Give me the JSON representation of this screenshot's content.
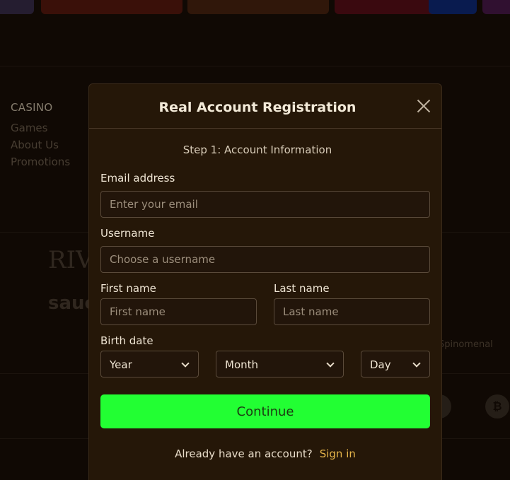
{
  "background": {
    "casino_heading": "CASINO",
    "casino_links": [
      "Games",
      "About Us",
      "Promotions"
    ],
    "providers": [
      "RIV",
      "sauc",
      "Spinomenal"
    ]
  },
  "modal": {
    "title": "Real Account Registration",
    "step": "Step 1: Account Information",
    "email": {
      "label": "Email address",
      "placeholder": "Enter your email",
      "value": ""
    },
    "username": {
      "label": "Username",
      "placeholder": "Choose a username",
      "value": ""
    },
    "first_name": {
      "label": "First name",
      "placeholder": "First name",
      "value": ""
    },
    "last_name": {
      "label": "Last name",
      "placeholder": "Last name",
      "value": ""
    },
    "birth_date": {
      "label": "Birth date",
      "year": "Year",
      "month": "Month",
      "day": "Day"
    },
    "continue_label": "Continue",
    "already_text": "Already have an account?",
    "signin_label": "Sign in"
  },
  "colors": {
    "background": "#1a0f07",
    "modal_bg": "#251708",
    "accent_green": "#22ff33",
    "link_gold": "#e6b54a"
  },
  "icons": [
    "close-icon",
    "chevron-down-icon",
    "bitcoin-icon"
  ]
}
